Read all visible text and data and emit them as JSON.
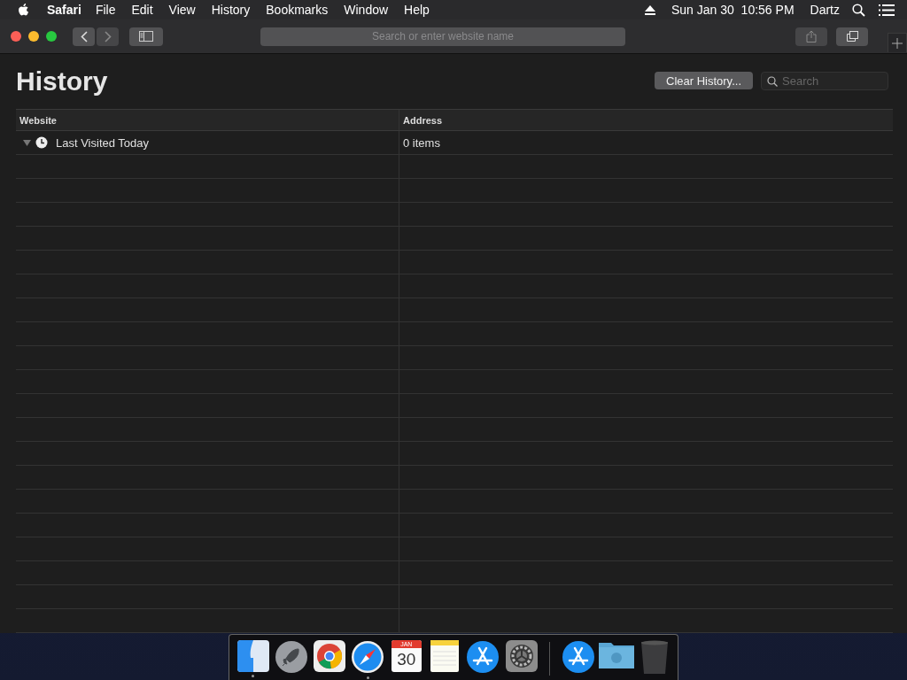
{
  "menu_bar": {
    "app_name": "Safari",
    "menus": [
      "File",
      "Edit",
      "View",
      "History",
      "Bookmarks",
      "Window",
      "Help"
    ],
    "clock": "Sun Jan 30  10:56 PM",
    "user": "Dartz"
  },
  "toolbar": {
    "address_placeholder": "Search or enter website name",
    "back_disabled": false,
    "forward_disabled": true,
    "share_disabled": true
  },
  "page": {
    "title": "History",
    "clear_button": "Clear History...",
    "search_placeholder": "Search"
  },
  "table": {
    "columns": [
      "Website",
      "Address"
    ],
    "rows": [
      {
        "website": "Last Visited Today",
        "address": "0 items",
        "expanded": true
      }
    ]
  },
  "dock": {
    "items": [
      {
        "kind": "finder",
        "running": true
      },
      {
        "kind": "launchpad",
        "running": false
      },
      {
        "kind": "chrome",
        "running": false
      },
      {
        "kind": "safari",
        "running": true
      },
      {
        "kind": "calendar",
        "running": false,
        "month": "JAN",
        "day": "30"
      },
      {
        "kind": "notes",
        "running": false
      },
      {
        "kind": "appstore",
        "running": false
      },
      {
        "kind": "settings",
        "running": false
      },
      {
        "kind": "separator"
      },
      {
        "kind": "appstore",
        "running": false
      },
      {
        "kind": "folder",
        "running": false
      },
      {
        "kind": "trash",
        "running": false
      }
    ]
  }
}
